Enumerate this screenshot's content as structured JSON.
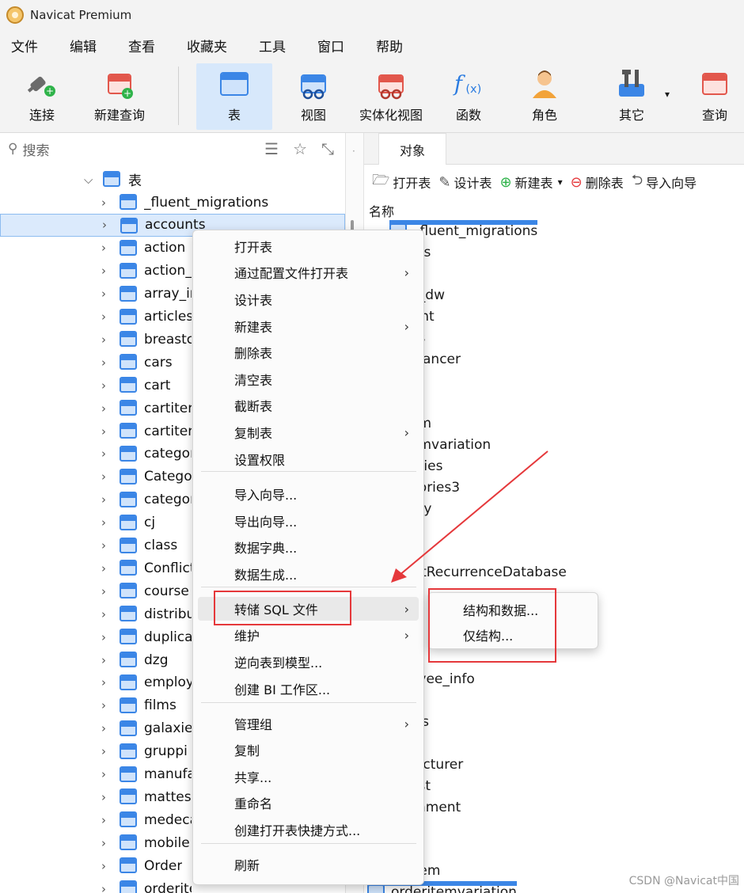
{
  "window": {
    "title": "Navicat Premium"
  },
  "menubar": [
    "文件",
    "编辑",
    "查看",
    "收藏夹",
    "工具",
    "窗口",
    "帮助"
  ],
  "toolbar": {
    "connect": "连接",
    "new_query": "新建查询",
    "table": "表",
    "view": "视图",
    "materialized_view": "实体化视图",
    "function": "函数",
    "role": "角色",
    "other": "其它",
    "query": "查询"
  },
  "search": {
    "placeholder": "搜索"
  },
  "tree": {
    "group_label": "表",
    "items": [
      "_fluent_migrations",
      "accounts",
      "action",
      "action_",
      "array_ir",
      "articles",
      "breastc",
      "cars",
      "cart",
      "cartiter",
      "cartiter",
      "categor",
      "Catego",
      "categor",
      "cj",
      "class",
      "Conflict",
      "course",
      "distribu",
      "duplica",
      "dzg",
      "employ",
      "films",
      "galaxie",
      "gruppi",
      "manufa",
      "mattes",
      "medeca",
      "mobile",
      "Order",
      "orderitem"
    ]
  },
  "right_pane": {
    "tab": "对象",
    "tools": {
      "open": "打开表",
      "design": "设计表",
      "new": "新建表",
      "delete": "删除表",
      "import": "导入向导"
    },
    "header": "名称",
    "visible_fragments": [
      "_fluent_migrations",
      "nts",
      "n",
      "n_dw",
      "_int",
      "es",
      "tcancer",
      "em",
      "emvariation",
      "ories",
      "gories3",
      "ory",
      "ictRecurrenceDatabase",
      "oyee_info",
      "ies",
      "pi",
      "facturer",
      "est",
      "cament",
      "le",
      "item",
      "orderitemvariation"
    ]
  },
  "context_menu": {
    "items": [
      {
        "label": "打开表",
        "submenu": false
      },
      {
        "label": "通过配置文件打开表",
        "submenu": true
      },
      {
        "label": "设计表",
        "submenu": false
      },
      {
        "label": "新建表",
        "submenu": true
      },
      {
        "label": "删除表",
        "submenu": false
      },
      {
        "label": "清空表",
        "submenu": false
      },
      {
        "label": "截断表",
        "submenu": false
      },
      {
        "label": "复制表",
        "submenu": true
      },
      {
        "label": "设置权限",
        "submenu": false
      },
      {
        "label": "导入向导...",
        "submenu": false
      },
      {
        "label": "导出向导...",
        "submenu": false
      },
      {
        "label": "数据字典...",
        "submenu": false
      },
      {
        "label": "数据生成...",
        "submenu": false
      },
      {
        "label": "转储 SQL 文件",
        "submenu": true
      },
      {
        "label": "维护",
        "submenu": true
      },
      {
        "label": "逆向表到模型...",
        "submenu": false
      },
      {
        "label": "创建 BI 工作区...",
        "submenu": false
      },
      {
        "label": "管理组",
        "submenu": true
      },
      {
        "label": "复制",
        "submenu": false
      },
      {
        "label": "共享...",
        "submenu": false
      },
      {
        "label": "重命名",
        "submenu": false
      },
      {
        "label": "创建打开表快捷方式...",
        "submenu": false
      },
      {
        "label": "刷新",
        "submenu": false
      }
    ],
    "submenu_items": [
      "结构和数据...",
      "仅结构..."
    ]
  },
  "watermark": "CSDN @Navicat中国",
  "colors": {
    "accent": "#3b86e6",
    "selection": "#dbeafc",
    "annotation": "#e5383b"
  }
}
